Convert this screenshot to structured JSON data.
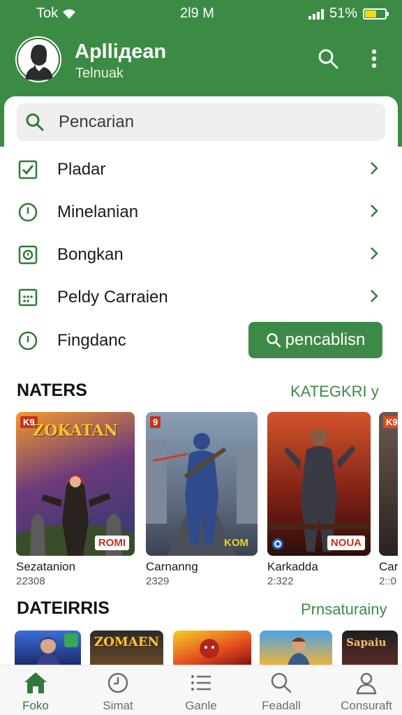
{
  "status_bar": {
    "carrier": "Tok",
    "time": "2Ɩ9 M",
    "battery": "51%"
  },
  "app_bar": {
    "title": "Aplliдean",
    "subtitle": "Telnuak"
  },
  "search": {
    "placeholder": "Pencarian"
  },
  "menu": [
    {
      "label": "Pladar",
      "icon": "checkbox-icon"
    },
    {
      "label": "Minelanian",
      "icon": "info-circle-icon"
    },
    {
      "label": "Bongkan",
      "icon": "badge-icon"
    },
    {
      "label": "Peldy Carraien",
      "icon": "calendar-icon"
    },
    {
      "label": "Fingdanc",
      "icon": "info-circle-icon"
    }
  ],
  "cta": {
    "label": "pencablisn"
  },
  "section1": {
    "title": "NATERS",
    "link": "KATEGKRI y",
    "items": [
      {
        "name": "Sezatanion",
        "num": "22308",
        "logo": "ZOKATAN",
        "badge": "ROMI",
        "corner": "K9"
      },
      {
        "name": "Carnanng",
        "num": "2329",
        "logo": "",
        "badge": "KOM",
        "corner": "9"
      },
      {
        "name": "Karkadda",
        "num": "2:322",
        "logo": "",
        "badge": "NOUA",
        "corner": ""
      },
      {
        "name": "Carr",
        "num": "2::0",
        "logo": "",
        "badge": "",
        "corner": "K9"
      }
    ]
  },
  "section2": {
    "title": "DATEIRRIS",
    "link": "Prnsaturainy",
    "items": [
      {
        "logo": ""
      },
      {
        "logo": "ZOMAEN"
      },
      {
        "logo": ""
      },
      {
        "logo": ""
      },
      {
        "logo": "Sapaiu"
      }
    ]
  },
  "bottom_nav": [
    {
      "label": "Foko",
      "icon": "home-icon",
      "active": true
    },
    {
      "label": "Simat",
      "icon": "clock-icon",
      "active": false
    },
    {
      "label": "Ganle",
      "icon": "list-icon",
      "active": false
    },
    {
      "label": "Feadall",
      "icon": "search-icon",
      "active": false
    },
    {
      "label": "Consuraft",
      "icon": "user-icon",
      "active": false
    }
  ],
  "colors": {
    "primary": "#3c8b45",
    "accent": "#3d8a46",
    "battery": "#f5d90a"
  }
}
